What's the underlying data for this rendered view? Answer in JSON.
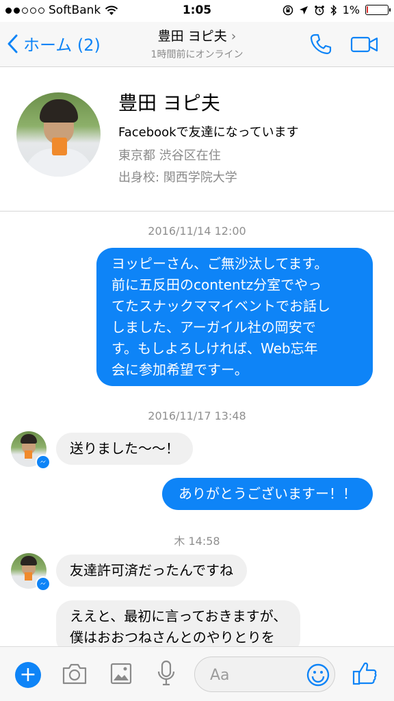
{
  "status_bar": {
    "carrier": "SoftBank",
    "time": "1:05",
    "battery_percent": "1%",
    "battery_level": 0.01,
    "signal_bars_filled": 2,
    "signal_bars_total": 5
  },
  "nav": {
    "back_label": "ホーム (2)",
    "title": "豊田 ヨピ夫",
    "subtitle": "1時間前にオンライン"
  },
  "profile": {
    "name": "豊田 ヨピ夫",
    "friend_status": "Facebookで友達になっています",
    "location": "東京都 渋谷区在住",
    "school": "出身校: 関西学院大学"
  },
  "messages": {
    "timestamp_1": "2016/11/14 12:00",
    "out_1": [
      "ヨッピーさん、ご無沙汰してます。",
      "前に五反田のcontentz分室でやっ",
      "てたスナックママイベントでお話し",
      "しました、アーガイル社の岡安で",
      "す。もしよろしければ、Web忘年",
      "会に参加希望ですー。"
    ],
    "timestamp_2": "2016/11/17 13:48",
    "in_1": "送りました〜〜！",
    "out_2": "ありがとうございますー！！",
    "timestamp_3": "木 14:58",
    "in_2": "友達許可済だったんですね",
    "in_3": [
      "ええと、最初に言っておきますが、",
      "僕はおおつねさんとのやりとりを"
    ]
  },
  "composer": {
    "placeholder": "Aa"
  },
  "colors": {
    "accent": "#0e84f7",
    "incoming_bubble": "#f0f0f0",
    "battery_low": "#e0302c"
  },
  "icons": {
    "back": "chevron-left-icon",
    "title_chevron": "chevron-right-icon",
    "phone": "phone-icon",
    "video": "video-camera-icon",
    "plus": "plus-icon",
    "camera": "camera-icon",
    "gallery": "image-icon",
    "mic": "microphone-icon",
    "emoji": "smiley-icon",
    "like": "thumbs-up-icon",
    "messenger_badge": "messenger-icon"
  }
}
